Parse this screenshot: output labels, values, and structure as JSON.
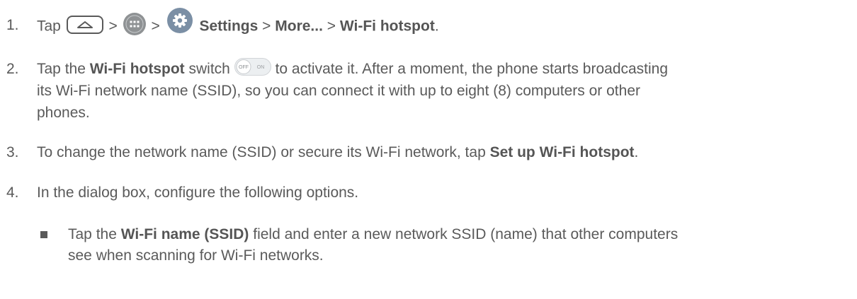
{
  "steps": [
    {
      "num": "1.",
      "parts": [
        "Tap",
        ">",
        ">",
        "Settings",
        ">",
        "More...",
        ">",
        "Wi-Fi hotspot",
        "."
      ],
      "icons": [
        "home-icon",
        "apps-icon",
        "settings-icon"
      ]
    },
    {
      "num": "2.",
      "lines": [
        [
          "Tap the",
          "Wi-Fi hotspot",
          "switch",
          "to activate it. After a moment, the phone starts broadcasting"
        ],
        "its Wi-Fi network name (SSID), so you can connect it with up to eight (8) computers or other",
        "phones."
      ],
      "toggle": {
        "off": "OFF",
        "on": "ON"
      }
    },
    {
      "num": "3.",
      "parts": [
        "To change the network name (SSID) or secure its Wi-Fi network, tap",
        "Set up Wi-Fi hotspot",
        "."
      ]
    },
    {
      "num": "4.",
      "text": "In the dialog box, configure the following options."
    }
  ],
  "sub_bullet": {
    "lines": [
      [
        "Tap the",
        "Wi-Fi name (SSID)",
        "field and enter a new network SSID (name) that other computers"
      ],
      "see when scanning for Wi-Fi networks."
    ]
  },
  "colors": {
    "text": "#5a5a5a",
    "settings_icon": "#7b8fa5",
    "apps_icon": "#8f9294"
  }
}
